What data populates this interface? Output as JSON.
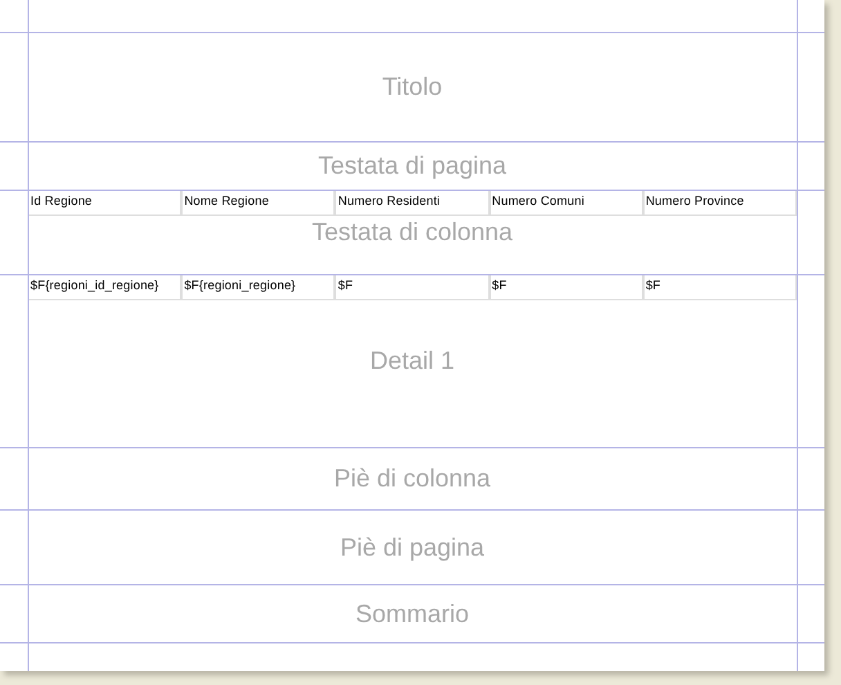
{
  "bands": [
    {
      "label": "Titolo"
    },
    {
      "label": "Testata di pagina"
    },
    {
      "label": "Testata di colonna",
      "fields": [
        "Id Regione",
        "Nome Regione",
        "Numero Residenti",
        "Numero Comuni",
        "Numero Province"
      ]
    },
    {
      "label": "Detail 1",
      "fields": [
        "$F{regioni_id_regione}",
        "$F{regioni_regione}",
        "$F",
        "$F",
        "$F"
      ]
    },
    {
      "label": "Piè di colonna"
    },
    {
      "label": "Piè di pagina"
    },
    {
      "label": "Sommario"
    }
  ]
}
